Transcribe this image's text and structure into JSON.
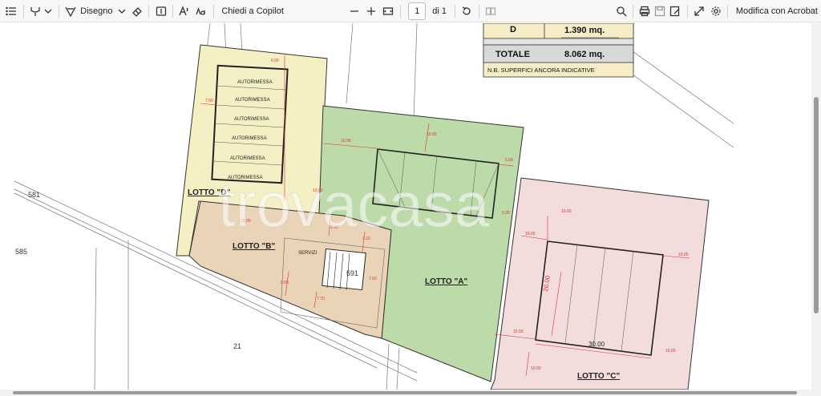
{
  "toolbar": {
    "draw_label": "Disegno",
    "copilot_label": "Chiedi a Copilot",
    "page_number": "1",
    "page_total": "di 1",
    "edit_acrobat_label": "Modifica con Acrobat"
  },
  "table": {
    "row_d_label": "D",
    "row_d_value": "1.390 mq.",
    "total_label": "TOTALE",
    "total_value": "8.062 mq.",
    "note": "N.B. SUPERFICI ANCORA INDICATIVE"
  },
  "lots": {
    "a": "LOTTO \"A\"",
    "b": "LOTTO \"B\"",
    "c": "LOTTO \"C\"",
    "d": "LOTTO \"D\""
  },
  "garage_label": "AUTORIMESSA",
  "services_label": "SERVIZI",
  "parcels": [
    "581",
    "585",
    "591",
    "21"
  ],
  "dimensions": {
    "c_width": "30.00",
    "c_height": "26.00"
  },
  "watermark": "trovacasa",
  "colors": {
    "lot_a": "#bcdba8",
    "lot_b": "#ead4b8",
    "lot_c": "#f3dcdc",
    "lot_d": "#f4f0c4",
    "table_bg": "#f6ecc5",
    "dimension": "#e03030"
  }
}
